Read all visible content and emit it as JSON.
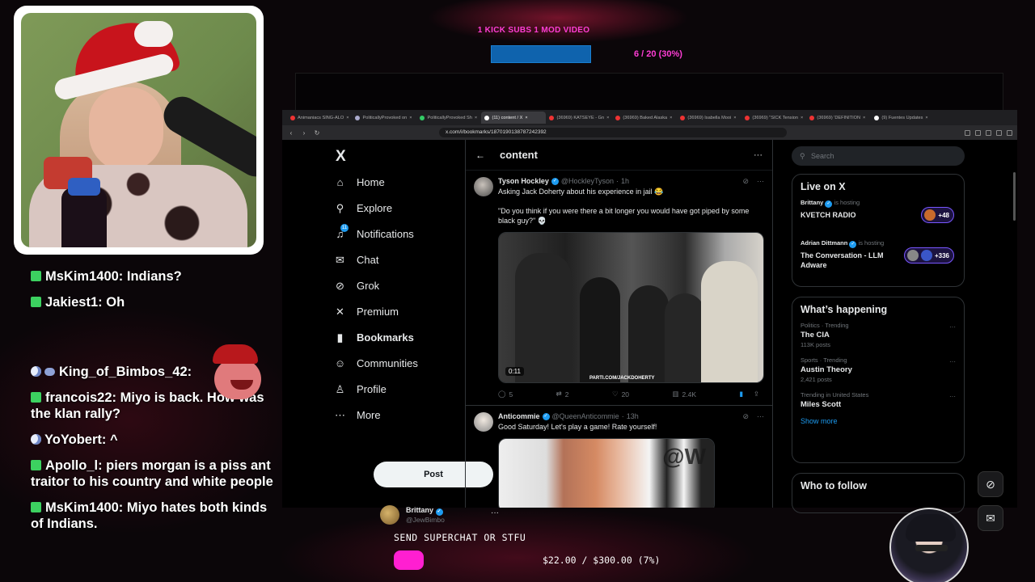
{
  "stream": {
    "goal_title": "1 KICK SUBS 1 MOD VIDEO",
    "goal_progress_text": "6 / 20 (30%)",
    "goal_progress_fraction": 0.3,
    "superchat_label": "SEND SUPERCHAT OR STFU",
    "superchat_amount": "$22.00 / $300.00 (7%)",
    "superchat_fraction": 0.07,
    "accent": "#ff1fd1"
  },
  "chat": {
    "messages": [
      {
        "user": "MsKim1400:",
        "text": "Indians?"
      },
      {
        "user": "Jakiest1:",
        "text": "Oh"
      },
      {
        "user": "King_of_Bimbos_42:",
        "text": ""
      },
      {
        "user": "francois22:",
        "text": "Miyo is back. How was the klan rally?"
      },
      {
        "user": "YoYobert:",
        "text": "^"
      },
      {
        "user": "Apollo_l:",
        "text": "piers morgan is a piss ant traitor to his country and white people"
      },
      {
        "user": "MsKim1400:",
        "text": "Miyo hates both kinds of Indians."
      }
    ]
  },
  "browser": {
    "tabs": [
      {
        "label": "Animaniacs SING-ALO",
        "color": "#e33"
      },
      {
        "label": "PoliticallyProvoked on",
        "color": "#aac"
      },
      {
        "label": "PoliticallyProvoked Sh",
        "color": "#3c6"
      },
      {
        "label": "(11) content / X",
        "color": "#fff",
        "active": true
      },
      {
        "label": "(36969) KATSEYE - Gn",
        "color": "#e33"
      },
      {
        "label": "(36969) Baked Alaska",
        "color": "#e33"
      },
      {
        "label": "(36969) Isabella Mooi",
        "color": "#e33"
      },
      {
        "label": "(36969) \"SICK Tension",
        "color": "#e33"
      },
      {
        "label": "(36969) 'DEFINITION",
        "color": "#e33"
      },
      {
        "label": "(9) Fuentes Updates",
        "color": "#fff"
      }
    ],
    "url": "x.com/i/bookmarks/1870190138787242392"
  },
  "nav": {
    "logo": "X",
    "items": [
      {
        "label": "Home",
        "icon": "home-icon",
        "glyph": "⌂"
      },
      {
        "label": "Explore",
        "icon": "search-icon",
        "glyph": "⚲"
      },
      {
        "label": "Notifications",
        "icon": "bell-icon",
        "glyph": "♫"
      },
      {
        "label": "Chat",
        "icon": "mail-icon",
        "glyph": "✉"
      },
      {
        "label": "Grok",
        "icon": "grok-icon",
        "glyph": "⊘"
      },
      {
        "label": "Premium",
        "icon": "x-icon",
        "glyph": "✕"
      },
      {
        "label": "Bookmarks",
        "icon": "bookmark-icon",
        "glyph": "▮"
      },
      {
        "label": "Communities",
        "icon": "people-icon",
        "glyph": "☺"
      },
      {
        "label": "Profile",
        "icon": "person-icon",
        "glyph": "♙"
      },
      {
        "label": "More",
        "icon": "more-circle-icon",
        "glyph": "⋯"
      }
    ],
    "notif_count": "11",
    "post_label": "Post",
    "account_name": "Brittany",
    "account_handle": "@JewBimbo"
  },
  "timeline": {
    "title": "content",
    "tweets": [
      {
        "name": "Tyson Hockley",
        "handle": "@HockleyTyson",
        "time": "1h",
        "text1": "Asking Jack Doherty about his experience in jail 😂",
        "text2": "\"Do you think if you were there a bit longer you would have got piped by some black guy?\" 💀",
        "video_time": "0:11",
        "video_caption": "PARTI.COM/JACKDOHERTY",
        "replies": "5",
        "reposts": "2",
        "likes": "20",
        "views": "2.4K"
      },
      {
        "name": "Anticommie",
        "handle": "@QueenAnticommie",
        "time": "13h",
        "text1": "Good Saturday! Let's play a game! Rate yourself!",
        "image_text": "@W"
      }
    ]
  },
  "sidebar": {
    "search_placeholder": "Search",
    "live_title": "Live on X",
    "live": [
      {
        "host": "Brittany",
        "hosting": "is hosting",
        "title": "KVETCH RADIO",
        "count": "+48"
      },
      {
        "host": "Adrian Dittmann",
        "hosting": "is hosting",
        "title": "The Conversation - LLM Adware",
        "count": "+336"
      }
    ],
    "happening_title": "What’s happening",
    "trends": [
      {
        "context": "Politics · Trending",
        "name": "The CIA",
        "posts": "113K posts"
      },
      {
        "context": "Sports · Trending",
        "name": "Austin Theory",
        "posts": "2,421 posts"
      },
      {
        "context": "Trending in United States",
        "name": "Miles Scott",
        "posts": ""
      }
    ],
    "show_more": "Show more",
    "follow_title": "Who to follow"
  }
}
